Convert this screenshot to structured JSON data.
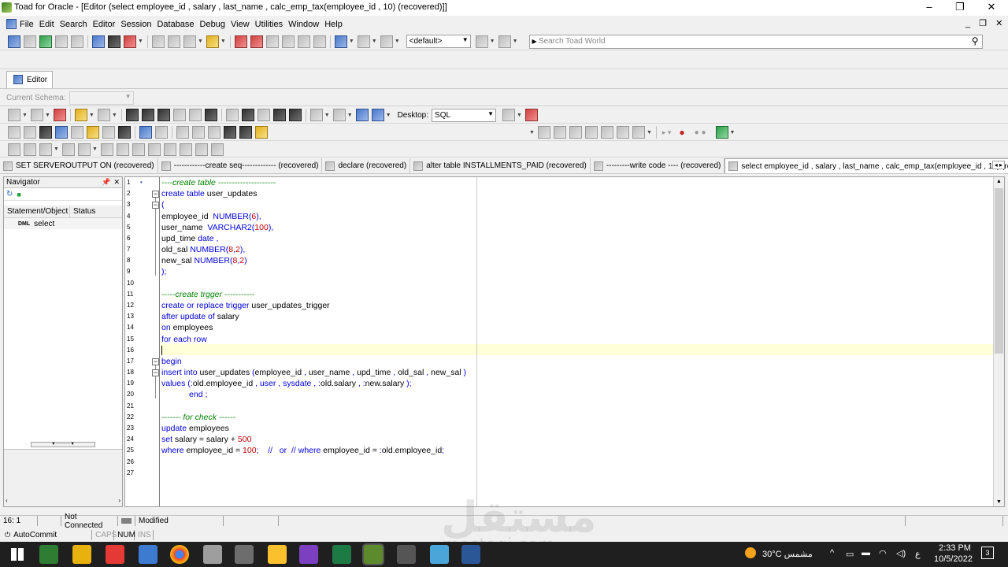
{
  "window": {
    "title": "Toad for Oracle - [Editor (select employee_id , salary , last_name , calc_emp_tax(employee_id , 10) (recovered)]]",
    "minimize": "–",
    "restore": "❐",
    "close": "✕"
  },
  "menu": [
    "File",
    "Edit",
    "Search",
    "Editor",
    "Session",
    "Database",
    "Debug",
    "View",
    "Utilities",
    "Window",
    "Help"
  ],
  "toolbar": {
    "connection_combo": "<default>",
    "search_placeholder": "Search Toad World"
  },
  "editor_tab": "Editor",
  "schema": {
    "label": "Current Schema:"
  },
  "editor_toolbar": {
    "desktop_label": "Desktop:",
    "desktop_value": "SQL"
  },
  "doc_tabs": [
    "SET SERVEROUTPUT ON (recovered)",
    "------------create seq------------- (recovered)",
    "declare (recovered)",
    "alter table INSTALLMENTS_PAID (recovered)",
    "---------write code ---- (recovered)",
    "select employee_id , salary , last_name , calc_emp_tax(employee_id , 10) (recovered)"
  ],
  "navigator": {
    "title": "Navigator",
    "columns": [
      "Statement/Object",
      "Status"
    ],
    "items": [
      {
        "type": "DML",
        "name": "select"
      }
    ]
  },
  "code_lines": [
    "----create table ---------------------",
    "create table user_updates",
    "(",
    "employee_id  NUMBER(6),",
    "user_name  VARCHAR2(100),",
    "upd_time date ,",
    "old_sal NUMBER(8,2),",
    "new_sal NUMBER(8,2)",
    ");",
    "",
    "-----create trgger -----------",
    "create or replace trigger user_updates_trigger",
    "after update of salary",
    "on employees",
    "for each row",
    "",
    "begin",
    "insert into user_updates (employee_id , user_name , upd_time , old_sal , new_sal )",
    "values (:old.employee_id , user , sysdate , :old.salary , :new.salary );",
    "            end ;",
    "",
    "------- for check ------",
    "update employees",
    "set salary = salary + 500",
    "where employee_id = 100;    //   or  // where employee_id = :old.employee_id;",
    "",
    ""
  ],
  "status": {
    "position": "16:  1",
    "connection": "Not Connected",
    "modified": "Modified",
    "autocommit": "AutoCommit",
    "caps": "CAPS",
    "num": "NUM",
    "ins": "INS"
  },
  "watermark": {
    "arabic": "مستقل",
    "latin": "mostaqi.com"
  },
  "taskbar": {
    "weather": "30°C  مشمس",
    "lang": "ع",
    "time": "2:33 PM",
    "date": "10/5/2022",
    "notifications": "3"
  }
}
